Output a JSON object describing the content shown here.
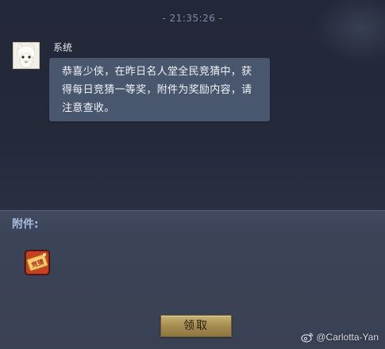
{
  "chat": {
    "timestamp": "- 21:35:26 -",
    "sender": "系统",
    "message": "恭喜少侠，在昨日名人堂全民竞猜中，获得每日竞猜一等奖，附件为奖励内容，请注意查收。",
    "avatar_icon": "alpaca-avatar-icon"
  },
  "attachment": {
    "label": "附件:",
    "item_icon": "lottery-ticket-icon",
    "item_icon_text": "竞猜"
  },
  "actions": {
    "claim_label": "领取"
  },
  "watermark": {
    "text": "@Carlotta-Yan",
    "icon": "weibo-icon"
  },
  "colors": {
    "bubble": "#49576e",
    "attach_label": "#a7bde0",
    "button_gold": "#b39d5f"
  }
}
